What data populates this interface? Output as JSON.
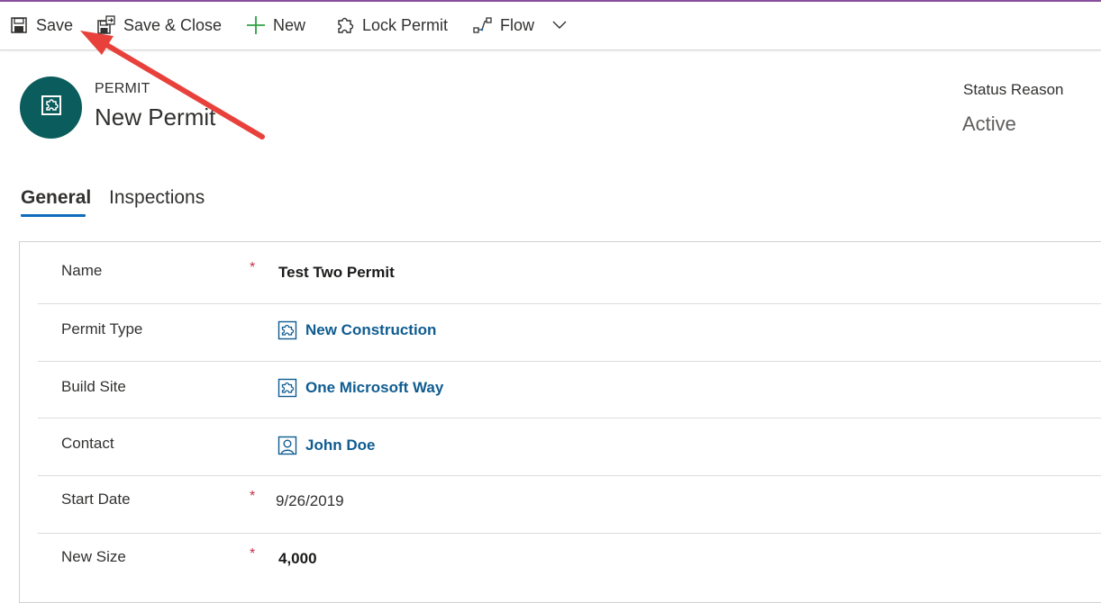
{
  "toolbar": {
    "save_label": "Save",
    "save_close_label": "Save & Close",
    "new_label": "New",
    "lock_permit_label": "Lock Permit",
    "flow_label": "Flow"
  },
  "header": {
    "entity_label": "PERMIT",
    "title": "New Permit",
    "status_label": "Status Reason",
    "status_value": "Active"
  },
  "tabs": [
    {
      "label": "General",
      "selected": true
    },
    {
      "label": "Inspections",
      "selected": false
    }
  ],
  "form": {
    "fields": [
      {
        "label": "Name",
        "required": "*",
        "value": "Test Two Permit"
      },
      {
        "label": "Permit Type",
        "value": "New Construction",
        "icon": "entity-icon"
      },
      {
        "label": "Build Site",
        "value": "One Microsoft Way",
        "icon": "entity-icon"
      },
      {
        "label": "Contact",
        "value": "John Doe",
        "icon": "contact-icon"
      },
      {
        "label": "Start Date",
        "required": "*",
        "value": "9/26/2019"
      },
      {
        "label": "New Size",
        "required": "*",
        "value": "4,000"
      }
    ]
  },
  "colors": {
    "accent": "#0f6cbd",
    "avatar": "#0b5c5c",
    "link": "#0f5c91",
    "required": "#c4314b",
    "annotation_arrow": "#e8413b"
  }
}
